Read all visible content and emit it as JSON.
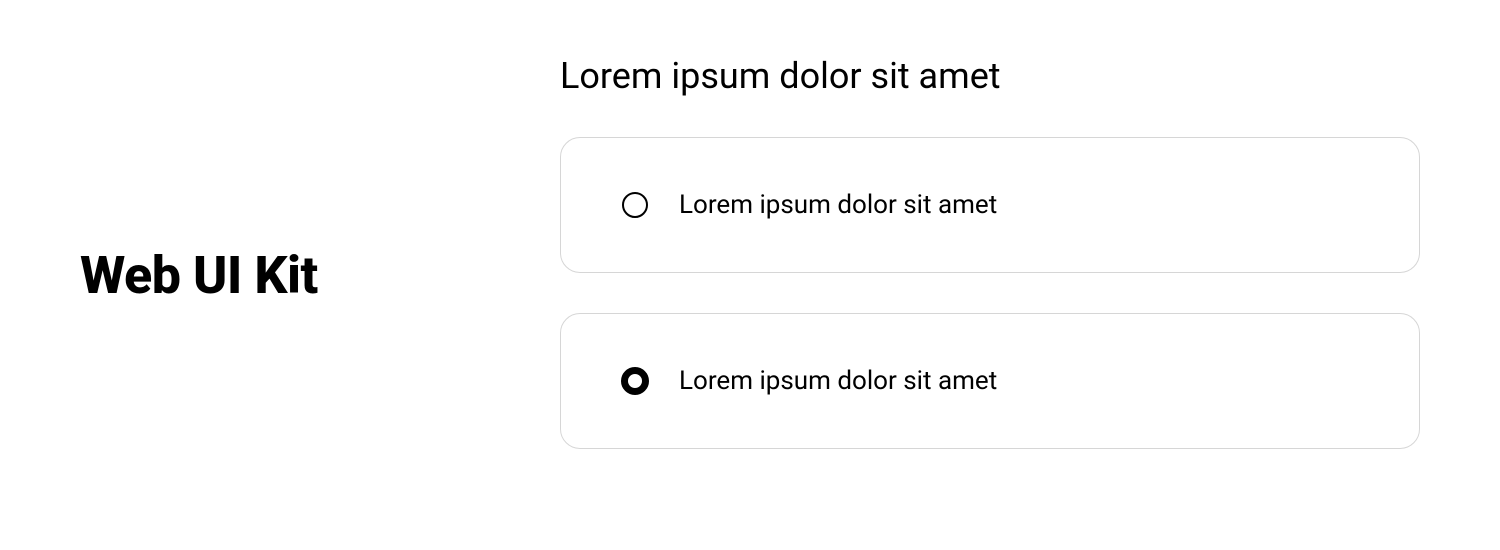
{
  "kit": {
    "title": "Web UI Kit"
  },
  "section": {
    "heading": "Lorem ipsum dolor sit amet"
  },
  "options": [
    {
      "label": "Lorem ipsum dolor sit amet",
      "selected": false
    },
    {
      "label": "Lorem ipsum dolor sit amet",
      "selected": true
    }
  ]
}
